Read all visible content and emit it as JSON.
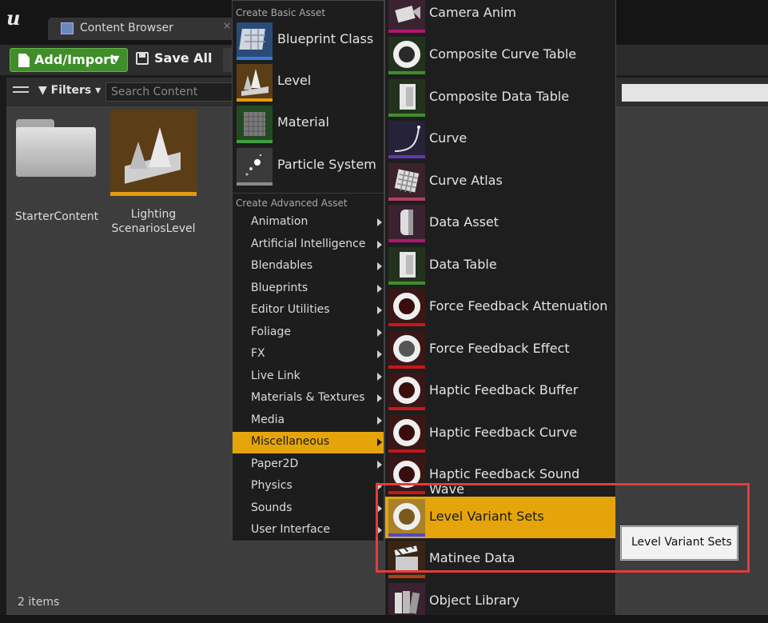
{
  "window": {
    "tab_title": "Content Browser",
    "tab_close": "×",
    "logo": "u"
  },
  "toolbar": {
    "add_import_label": "Add/Import",
    "add_import_caret": "▼",
    "save_all_label": "Save All"
  },
  "filter_bar": {
    "filters_label": "Filters",
    "filters_caret": "▾",
    "search_placeholder": "Search Content"
  },
  "assets": [
    {
      "name": "StarterContent",
      "kind": "folder"
    },
    {
      "name": "Lighting\nScenariosLevel",
      "kind": "level"
    }
  ],
  "status": {
    "items_count": "2 items"
  },
  "menu": {
    "basic_header": "Create Basic Asset",
    "basic_items": [
      {
        "label": "Blueprint Class",
        "icon": "blueprint-class-icon",
        "bar_color": "#3b7bd6"
      },
      {
        "label": "Level",
        "icon": "level-icon",
        "bar_color": "#e49a0e"
      },
      {
        "label": "Material",
        "icon": "material-icon",
        "bar_color": "#3fa03f"
      },
      {
        "label": "Particle System",
        "icon": "particle-system-icon",
        "bar_color": "#8a8a8a"
      }
    ],
    "advanced_header": "Create Advanced Asset",
    "advanced_items": [
      "Animation",
      "Artificial Intelligence",
      "Blendables",
      "Blueprints",
      "Editor Utilities",
      "Foliage",
      "FX",
      "Live Link",
      "Materials & Textures",
      "Media",
      "Miscellaneous",
      "Paper2D",
      "Physics",
      "Sounds",
      "User Interface"
    ],
    "active_advanced_item": "Miscellaneous"
  },
  "submenu": {
    "items": [
      {
        "label": "Camera Anim",
        "icon": "camera-anim-icon",
        "bar_color": "#b0166e"
      },
      {
        "label": "Composite Curve Table",
        "icon": "composite-curve-table-icon",
        "bar_color": "#3f8e2a"
      },
      {
        "label": "Composite Data Table",
        "icon": "composite-data-table-icon",
        "bar_color": "#3f8e2a"
      },
      {
        "label": "Curve",
        "icon": "curve-icon",
        "bar_color": "#5e3ab0"
      },
      {
        "label": "Curve Atlas",
        "icon": "curve-atlas-icon",
        "bar_color": "#b04060"
      },
      {
        "label": "Data Asset",
        "icon": "data-asset-icon",
        "bar_color": "#b0166e"
      },
      {
        "label": "Data Table",
        "icon": "data-table-icon",
        "bar_color": "#3f8e2a"
      },
      {
        "label": "Force Feedback Attenuation",
        "icon": "force-feedback-attenuation-icon",
        "bar_color": "#c41818"
      },
      {
        "label": "Force Feedback Effect",
        "icon": "force-feedback-effect-icon",
        "bar_color": "#c41818"
      },
      {
        "label": "Haptic Feedback Buffer",
        "icon": "haptic-feedback-buffer-icon",
        "bar_color": "#c41818"
      },
      {
        "label": "Haptic Feedback Curve",
        "icon": "haptic-feedback-curve-icon",
        "bar_color": "#c41818"
      },
      {
        "label": "Haptic Feedback Sound Wave",
        "icon": "haptic-feedback-sound-wave-icon",
        "bar_color": "#c41818"
      },
      {
        "label": "Level Variant Sets",
        "icon": "level-variant-sets-icon",
        "bar_color": "#4a4ad0"
      },
      {
        "label": "Matinee Data",
        "icon": "matinee-data-icon",
        "bar_color": "#b04010"
      },
      {
        "label": "Object Library",
        "icon": "object-library-icon",
        "bar_color": "#d84a8a"
      }
    ],
    "active_item": "Level Variant Sets"
  },
  "tooltip": {
    "text": "Level Variant Sets"
  },
  "colors": {
    "highlight": "#e5a50a",
    "annotation_box": "#e43c3c",
    "add_button": "#3f8e2a"
  }
}
